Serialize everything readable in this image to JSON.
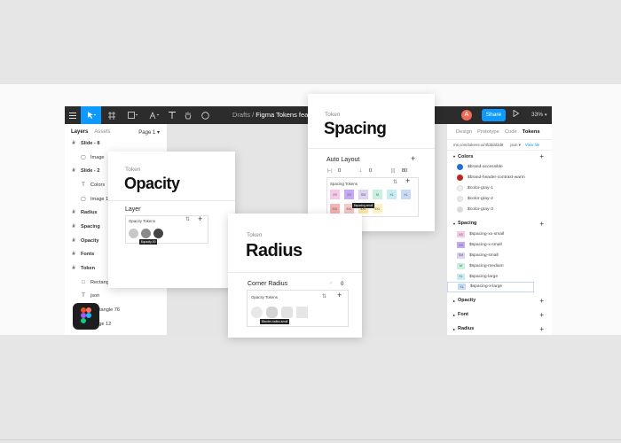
{
  "toolbar": {
    "breadcrumb_parent": "Drafts",
    "breadcrumb_separator": "/",
    "file_name": "Figma Tokens fea",
    "avatar_initial": "A",
    "share_label": "Share",
    "zoom": "33%",
    "icons": [
      "menu-icon",
      "move-tool-icon",
      "frame-tool-icon",
      "shape-tool-icon",
      "pen-tool-icon",
      "text-tool-icon",
      "hand-tool-icon",
      "comment-tool-icon",
      "play-icon"
    ]
  },
  "layers_panel": {
    "tab_layers": "Layers",
    "tab_assets": "Assets",
    "page_selector": "Page 1",
    "items": [
      {
        "label": "Slide - 8",
        "level": 0,
        "bold": true,
        "icon": "frame-icon"
      },
      {
        "label": "Image",
        "level": 1,
        "bold": false,
        "icon": "image-icon"
      },
      {
        "label": "Slide - 2",
        "level": 0,
        "bold": true,
        "icon": "frame-icon"
      },
      {
        "label": "Colors",
        "level": 1,
        "bold": false,
        "icon": "text-icon"
      },
      {
        "label": "Image 1",
        "level": 1,
        "bold": false,
        "icon": "image-icon"
      },
      {
        "label": "Radius",
        "level": 0,
        "bold": true,
        "icon": "frame-icon"
      },
      {
        "label": "Spacing",
        "level": 0,
        "bold": true,
        "icon": "frame-icon"
      },
      {
        "label": "Opacity",
        "level": 0,
        "bold": true,
        "icon": "frame-icon"
      },
      {
        "label": "Fonts",
        "level": 0,
        "bold": true,
        "icon": "frame-icon"
      },
      {
        "label": "Token",
        "level": 0,
        "bold": true,
        "icon": "frame-icon"
      },
      {
        "label": "Rectangle",
        "level": 1,
        "bold": false,
        "icon": "rectangle-icon"
      },
      {
        "label": "json",
        "level": 1,
        "bold": false,
        "icon": "text-icon"
      },
      {
        "label": "Rectangle 76",
        "level": 1,
        "bold": false,
        "icon": "rectangle-icon"
      },
      {
        "label": "Image 12",
        "level": 1,
        "bold": false,
        "icon": "image-icon"
      },
      {
        "label": "Group 12",
        "level": 1,
        "bold": false,
        "icon": "group-icon"
      }
    ]
  },
  "tokens_panel": {
    "tabs": [
      "Design",
      "Prototype",
      "Code",
      "Tokens"
    ],
    "active_tab": "Tokens",
    "url": "ms.com/tokens-ui/4fdddd3d8",
    "format": "json",
    "view_link": "View file",
    "colors_heading": "Colors",
    "colors": [
      {
        "name": "$brand-accessible",
        "color": "#1e6fd9"
      },
      {
        "name": "$brand-header-contrast-warm",
        "color": "#c0261f"
      },
      {
        "name": "$color-gray-1",
        "color": "#f0f0f0"
      },
      {
        "name": "$color-gray-2",
        "color": "#e6e6e6"
      },
      {
        "name": "$color-gray-3",
        "color": "#dadada"
      }
    ],
    "spacing_heading": "Spacing",
    "spacing": [
      {
        "name": "$spacing-xx-small",
        "badge": "XS",
        "color": "#f6c9e9"
      },
      {
        "name": "$spacing-x-small",
        "badge": "XS",
        "color": "#c5a9f2"
      },
      {
        "name": "$spacing-small",
        "badge": "SM",
        "color": "#dcd3f4"
      },
      {
        "name": "$spacing-medium",
        "badge": "M",
        "color": "#c9f0df"
      },
      {
        "name": "$spacing-large",
        "badge": "XL",
        "color": "#c5edf2"
      },
      {
        "name": "$spacing-x-large",
        "badge": "XL",
        "color": "#c8d9f6"
      }
    ],
    "opacity_heading": "Opacity",
    "font_heading": "Font",
    "radius_heading": "Radius"
  },
  "cards": {
    "opacity": {
      "kicker": "Token",
      "title": "Opacity",
      "section": "Layer",
      "box_title": "Opacity Tokens",
      "tooltip": "$opacity-50"
    },
    "spacing": {
      "kicker": "Token",
      "title": "Spacing",
      "section": "Auto Layout",
      "val1": "0",
      "val2": "0",
      "val3": "80",
      "box_title": "Spacing Tokens",
      "tooltip": "$spacing-small",
      "row1": [
        "XS",
        "XS",
        "SM",
        "M",
        "XL",
        "XL"
      ],
      "row1_colors": [
        "#f6c9e9",
        "#c5a9f2",
        "#dcd3f4",
        "#c9f0df",
        "#c5edf2",
        "#c8d9f6"
      ],
      "row2": [
        "2XL",
        "3XL",
        "4XL",
        "5XL"
      ],
      "row2_colors": [
        "#f5b3b3",
        "#f6c8c8",
        "#fbe6a8",
        "#fdf1c2"
      ]
    },
    "radius": {
      "kicker": "Token",
      "title": "Radius",
      "section": "Corner Radius",
      "value": "0",
      "box_title": "Opacity Tokens",
      "tooltip": "$border-radius-small"
    }
  }
}
